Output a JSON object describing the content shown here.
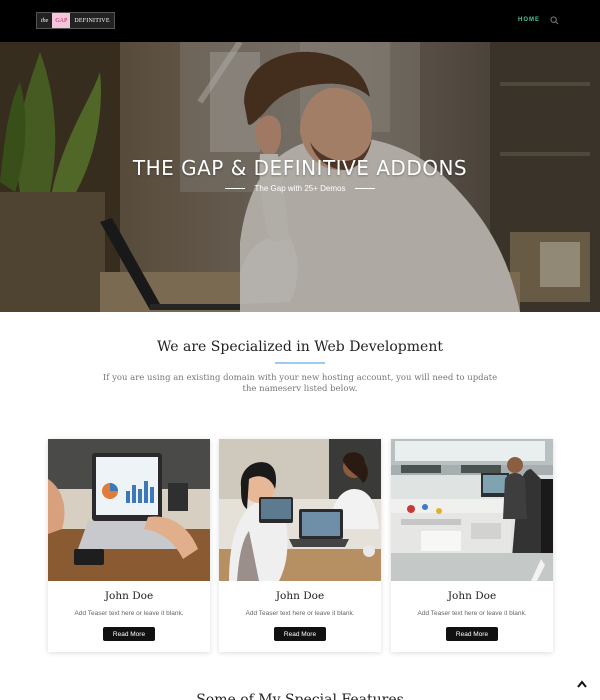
{
  "header": {
    "logo": {
      "part1": "the",
      "part2": "GAP",
      "part3": "DEFINITIVE"
    },
    "nav_home": "HOME",
    "colors": {
      "background": "#000000",
      "nav_active": "#3ec89a"
    },
    "search_icon": "search-icon"
  },
  "hero": {
    "title": "THE GAP & DEFINITIVE ADDONS",
    "subtitle": "The Gap with 25+ Demos"
  },
  "section": {
    "title": "We are Specialized in Web Development",
    "description": "If you are using an existing domain with your new hosting account, you will need to update the nameserv listed below.",
    "rule_color": "#9ccaf0"
  },
  "cards": [
    {
      "name": "John Doe",
      "teaser": "Add Teaser text here or leave it blank.",
      "button": "Read More"
    },
    {
      "name": "John Doe",
      "teaser": "Add Teaser text here or leave it blank.",
      "button": "Read More"
    },
    {
      "name": "John Doe",
      "teaser": "Add Teaser text here or leave it blank.",
      "button": "Read More"
    }
  ],
  "next_section": {
    "title": "Some of My Special Features"
  },
  "back_to_top_icon": "chevron-up-icon"
}
